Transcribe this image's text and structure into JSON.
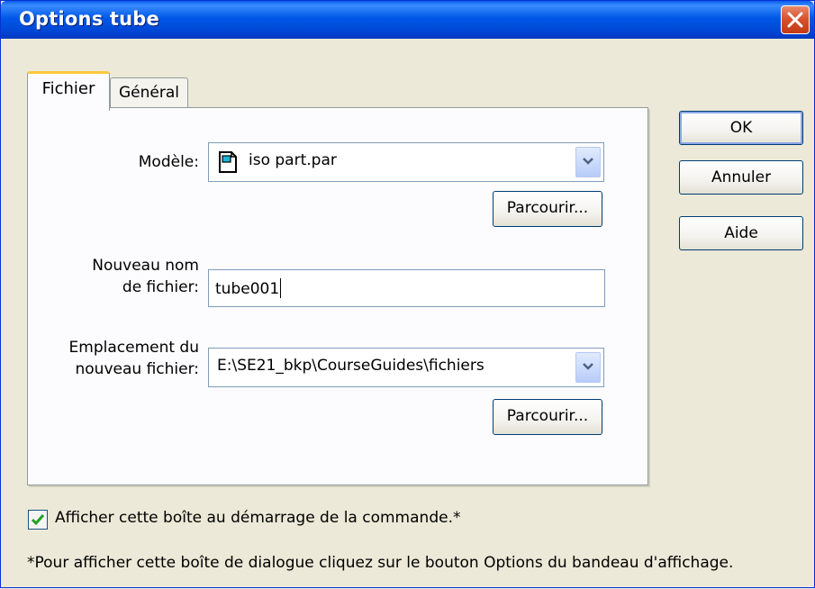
{
  "window": {
    "title": "Options tube"
  },
  "tabs": [
    {
      "label": "Fichier",
      "active": true
    },
    {
      "label": "Général",
      "active": false
    }
  ],
  "form": {
    "modele_label": "Modèle:",
    "modele_value": "iso part.par",
    "parcourir_1": "Parcourir...",
    "nouveau_nom_label_1": "Nouveau nom",
    "nouveau_nom_label_2": "de fichier:",
    "nouveau_nom_value": "tube001",
    "emplacement_label_1": "Emplacement du",
    "emplacement_label_2": "nouveau fichier:",
    "emplacement_value": "E:\\SE21_bkp\\CourseGuides\\fichiers",
    "parcourir_2": "Parcourir..."
  },
  "buttons": {
    "ok": "OK",
    "annuler": "Annuler",
    "aide": "Aide"
  },
  "checkbox": {
    "label": "Afficher cette boîte au démarrage de la commande.*",
    "checked": true
  },
  "footnote": "*Pour afficher cette boîte de dialogue cliquez sur le bouton Options du bandeau d'affichage.",
  "colors": {
    "title_bar": "#0058E6",
    "window_bg": "#ECE9D8",
    "close_button": "#D8532E",
    "checkmark": "#21A121"
  }
}
